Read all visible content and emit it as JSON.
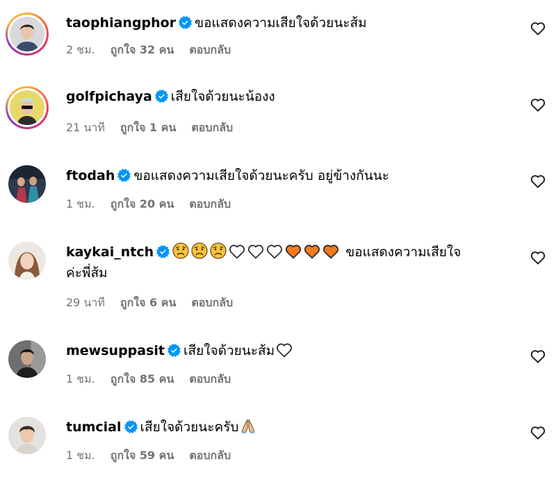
{
  "comments": [
    {
      "username": "taophiangphor",
      "text": "ขอแสดงความเสียใจด้วยนะส้ม",
      "time": "2 ชม.",
      "likes": "ถูกใจ 32 คน",
      "reply": "ตอบกลับ"
    },
    {
      "username": "golfpichaya",
      "text": "เสียใจด้วยนะน้องง",
      "time": "21 นาที",
      "likes": "ถูกใจ 1 คน",
      "reply": "ตอบกลับ"
    },
    {
      "username": "ftodah",
      "text": "ขอแสดงความเสียใจด้วยนะครับ อยู่ข้างกันนะ",
      "time": "1 ชม.",
      "likes": "ถูกใจ 20 คน",
      "reply": "ตอบกลับ"
    },
    {
      "username": "kaykai_ntch",
      "text_after_emoji": "ขอแสดงความเสียใจ",
      "text_line2": "ค่ะพี่ส้ม",
      "time": "29 นาที",
      "likes": "ถูกใจ 6 คน",
      "reply": "ตอบกลับ"
    },
    {
      "username": "mewsuppasit",
      "text": "เสียใจด้วยนะส้ม",
      "time": "1 ชม.",
      "likes": "ถูกใจ 85 คน",
      "reply": "ตอบกลับ"
    },
    {
      "username": "tumcial",
      "text": "เสียใจด้วยนะครับ",
      "time": "1 ชม.",
      "likes": "ถูกใจ 59 คน",
      "reply": "ตอบกลับ"
    }
  ],
  "colors": {
    "verified": "#0095f6",
    "meta": "#737373",
    "orange_heart": "#f4791f"
  },
  "icons": {
    "verified": "verified-badge-icon",
    "like": "heart-outline-icon",
    "sad": "sad-face-emoji",
    "white_heart": "white-heart-emoji",
    "orange_heart": "orange-heart-emoji",
    "pray": "folded-hands-emoji"
  }
}
